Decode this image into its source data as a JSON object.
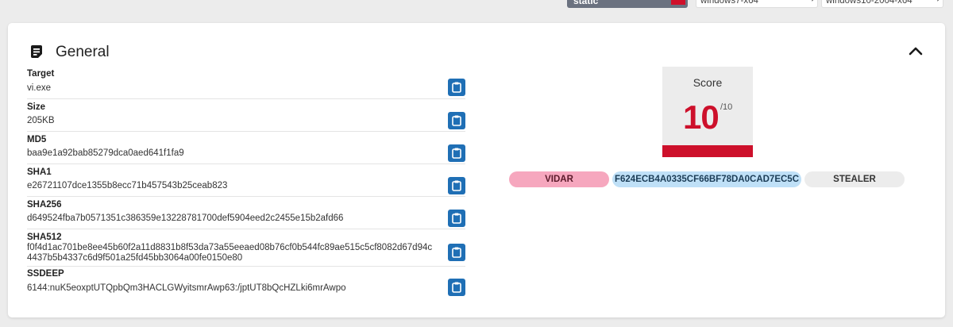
{
  "top_tabs": {
    "static_label": "static",
    "vm1_label": "windows7-x64",
    "vm2_label": "windows10-2004-x64"
  },
  "card": {
    "title": "General",
    "icon": "document-icon",
    "collapse_icon": "chevron-up-icon"
  },
  "fields": [
    {
      "label": "Target",
      "value": "vi.exe"
    },
    {
      "label": "Size",
      "value": "205KB"
    },
    {
      "label": "MD5",
      "value": "baa9e1a92bab85279dca0aed641f1fa9"
    },
    {
      "label": "SHA1",
      "value": "e26721107dce1355b8ecc71b457543b25ceab823"
    },
    {
      "label": "SHA256",
      "value": "d649524fba7b0571351c386359e13228781700def5904eed2c2455e15b2afd66"
    },
    {
      "label": "SHA512",
      "value_line1": "f0f4d1ac701be8ee45b60f2a11d8831b8f53da73a55eeaed08b76cf0b544fc89ae515c5cf8082d67d94c",
      "value_line2": "4437b5b4337c6d9f501a25fd45bb3064a00fe0150e80"
    },
    {
      "label": "SSDEEP",
      "value": "6144:nuK5eoxptUTQpbQm3HACLGWyitsmrAwp63:/jptUT8bQcHZLki6mrAwpo"
    }
  ],
  "score": {
    "label": "Score",
    "value": "10",
    "max": "/10",
    "color": "#cd102b"
  },
  "tags": [
    {
      "text": "VIDAR",
      "color": "#f6a7be"
    },
    {
      "text": "F624ECB4A0335CF66BF78DA0CAD7EC5C",
      "color": "#bfe0f7"
    },
    {
      "text": "STEALER",
      "color": "#ececec"
    }
  ],
  "colors": {
    "accent_blue": "#1f6fb5",
    "static_tab": "#6b7280"
  }
}
